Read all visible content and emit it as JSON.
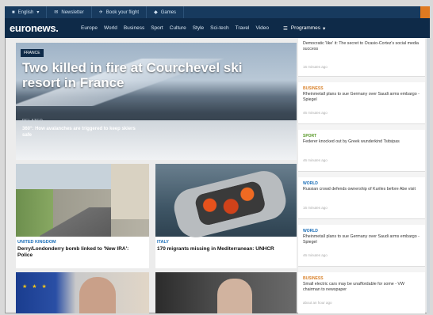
{
  "topbar": {
    "language": "English",
    "newsletter": "Newsletter",
    "book_flight": "Book your flight",
    "games": "Games"
  },
  "nav": {
    "logo": "euronews.",
    "items": [
      "Europe",
      "World",
      "Business",
      "Sport",
      "Culture",
      "Style",
      "Sci-tech",
      "Travel",
      "Video"
    ],
    "programmes": "Programmes"
  },
  "hero": {
    "badge": "FRANCE",
    "title": "Two killed in fire at Courchevel ski resort in France",
    "related_label": "RELATED",
    "related_text": "360°: How avalanches are triggered to keep skiers safe"
  },
  "cards": [
    {
      "tag": "UNITED KINGDOM",
      "headline": "Derry/Londonderry bomb linked to 'New IRA': Police"
    },
    {
      "tag": "ITALY",
      "headline": "170 migrants missing in Mediterranean: UNHCR"
    }
  ],
  "sidebar": [
    {
      "category": "",
      "text": "Democratic 'like' it: The secret to Ocasio-Cortez's social media success",
      "time": "16 minutes ago"
    },
    {
      "category": "BUSINESS",
      "text": "Rheinmetall plans to sue Germany over Saudi arms embargo - Spiegel",
      "time": "46 minutes ago"
    },
    {
      "category": "SPORT",
      "text": "Federer knocked out by Greek wunderkind Tsitsipas",
      "time": "46 minutes ago"
    },
    {
      "category": "WORLD",
      "text": "Russian crowd defends ownership of Kuriles before Abe visit",
      "time": "16 minutes ago"
    },
    {
      "category": "WORLD",
      "text": "Rheinmetall plans to sue Germany over Saudi arms embargo - Spiegel",
      "time": "46 minutes ago"
    },
    {
      "category": "BUSINESS",
      "text": "Small electric cars may be unaffordable for some - VW chairman to newspaper",
      "time": "about an hour ago"
    }
  ],
  "icons": {
    "flag": "flag-icon",
    "newsletter": "envelope-icon",
    "flight": "plane-icon",
    "games": "gamepad-icon",
    "menu": "menu-icon"
  },
  "colors": {
    "brand_navy": "#0e2a48",
    "link_blue": "#1c6fb8",
    "orange": "#d9822b",
    "green": "#5a9a2a"
  }
}
